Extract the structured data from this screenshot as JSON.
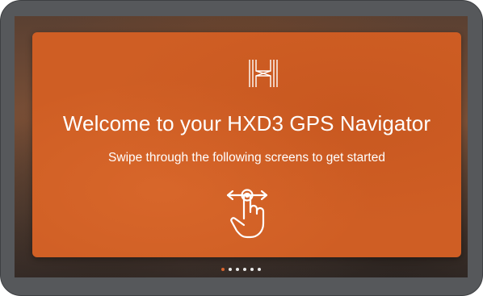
{
  "welcome": {
    "title": "Welcome to your HXD3 GPS Navigator",
    "subtitle": "Swipe through the following screens to get started"
  },
  "icons": {
    "logo": "h-logo-icon",
    "swipe": "swipe-gesture-icon"
  },
  "pager": {
    "total": 6,
    "active_index": 0
  },
  "colors": {
    "card": "#cf5e24",
    "bezel": "#56585b",
    "text": "#ffffff",
    "active_dot": "#d8642e",
    "inactive_dot": "#e8e8e8"
  }
}
